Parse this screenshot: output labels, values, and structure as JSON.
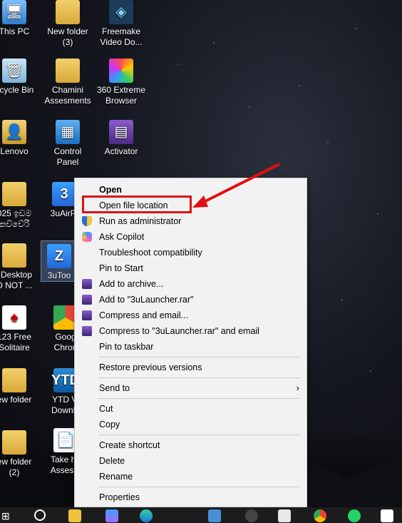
{
  "desktop_icons": [
    {
      "label": "This PC"
    },
    {
      "label": "New folder\n(3)"
    },
    {
      "label": "Freemake\nVideo Do..."
    },
    {
      "label": "ecycle Bin"
    },
    {
      "label": "Chamini\nAssesments"
    },
    {
      "label": "360 Extreme\nBrowser"
    },
    {
      "label": "Lenovo"
    },
    {
      "label": "Control\nPanel"
    },
    {
      "label": "Activator"
    },
    {
      "label": "025 ඉඩම\nකච්චේරි"
    },
    {
      "label": "3uAirPl"
    },
    {
      "label": "l Desktop\nO NOT ..."
    },
    {
      "label": "3uToo"
    },
    {
      "label": "123 Free\nSolitaire"
    },
    {
      "label": "Goog\nChron"
    },
    {
      "label": "ew folder"
    },
    {
      "label": "YTD Vi\nDownlo"
    },
    {
      "label": "ew folder\n(2)"
    },
    {
      "label": "Take ho\nAssesm"
    }
  ],
  "context_menu": {
    "items": [
      {
        "label": "Open",
        "bold": true
      },
      {
        "label": "Open file location"
      },
      {
        "label": "Run as administrator",
        "icon": "shield-icon"
      },
      {
        "label": "Ask Copilot",
        "icon": "copilot-icon"
      },
      {
        "label": "Troubleshoot compatibility"
      },
      {
        "label": "Pin to Start"
      },
      {
        "label": "Add to archive...",
        "icon": "winrar-icon"
      },
      {
        "label": "Add to \"3uLauncher.rar\"",
        "icon": "winrar-icon"
      },
      {
        "label": "Compress and email...",
        "icon": "winrar-icon"
      },
      {
        "label": "Compress to \"3uLauncher.rar\" and email",
        "icon": "winrar-icon"
      },
      {
        "label": "Pin to taskbar"
      },
      {
        "label": "Restore previous versions"
      },
      {
        "label": "Send to"
      },
      {
        "label": "Cut"
      },
      {
        "label": "Copy"
      },
      {
        "label": "Create shortcut"
      },
      {
        "label": "Delete"
      },
      {
        "label": "Rename"
      },
      {
        "label": "Properties"
      }
    ]
  },
  "annotation_color": "#e01010"
}
